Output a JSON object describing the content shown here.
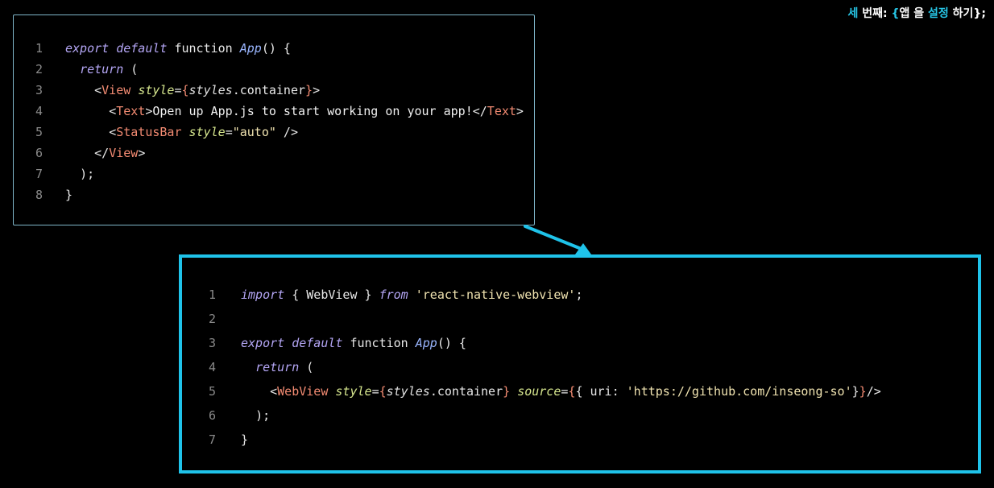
{
  "header": {
    "step_label": "세 번째:",
    "brace_open": "{",
    "word_app": "앱",
    "word_eul": "을",
    "word_setup": "설정",
    "word_hagi": "하기",
    "brace_close": "};"
  },
  "colors": {
    "accent": "#1fc3ea",
    "background": "#000000",
    "keyword": "#b4a6f5",
    "tag": "#f38b72",
    "attribute": "#d6e68e",
    "string": "#f0e3b0"
  },
  "before_code": {
    "line_numbers": [
      "1",
      "2",
      "3",
      "4",
      "5",
      "6",
      "7",
      "8"
    ],
    "l1": {
      "kw": "export default",
      "fn_kw": "function",
      "name": "App",
      "rest": "() {"
    },
    "l2": {
      "kw": "return",
      "rest": " ("
    },
    "l3": {
      "open": "<",
      "tag": "View",
      "attr": "style",
      "eq": "=",
      "b1": "{",
      "obj": "styles",
      "dot": ".container",
      "b2": "}",
      "close": ">"
    },
    "l4": {
      "open": "<",
      "tag": "Text",
      "gt": ">",
      "text": "Open up App.js to start working on your app!",
      "close_open": "</",
      "close_tag": "Text",
      "close_gt": ">"
    },
    "l5": {
      "open": "<",
      "tag": "StatusBar",
      "attr": "style",
      "eq": "=",
      "val": "\"auto\"",
      "close": " />"
    },
    "l6": {
      "open": "</",
      "tag": "View",
      "close": ">"
    },
    "l7": {
      "text": ");"
    },
    "l8": {
      "text": "}"
    }
  },
  "after_code": {
    "line_numbers": [
      "1",
      "2",
      "3",
      "4",
      "5",
      "6",
      "7"
    ],
    "l1": {
      "kw": "import",
      "mid": " { WebView } ",
      "from": "from",
      "str": "'react-native-webview'",
      "end": ";"
    },
    "l3": {
      "kw": "export default",
      "fn_kw": "function",
      "name": "App",
      "rest": "() {"
    },
    "l4": {
      "kw": "return",
      "rest": " ("
    },
    "l5": {
      "open": "<",
      "tag": "WebView",
      "attr1": "style",
      "eq1": "=",
      "b1": "{",
      "obj": "styles",
      "dot": ".container",
      "b2": "}",
      "attr2": "source",
      "eq2": "=",
      "b3": "{",
      "inner": "{ uri: ",
      "str": "'https://github.com/inseong-so'",
      "inner_end": "}",
      "b4": "}",
      "close": "/>"
    },
    "l6": {
      "text": ");"
    },
    "l7": {
      "text": "}"
    }
  }
}
